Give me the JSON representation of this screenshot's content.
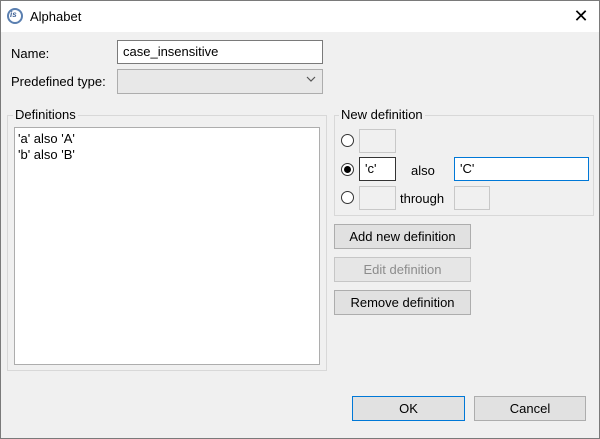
{
  "window": {
    "title": "Alphabet"
  },
  "form": {
    "name_label": "Name:",
    "name_value": "case_insensitive",
    "predefined_label": "Predefined type:",
    "predefined_value": ""
  },
  "definitions": {
    "title": "Definitions",
    "items": [
      "'a' also 'A'",
      "'b' also 'B'"
    ]
  },
  "new_definition": {
    "title": "New definition",
    "single_value": "",
    "also_from": "'c'",
    "also_label": "also",
    "also_to": "'C'",
    "through_from": "",
    "through_label": "through",
    "through_to": "",
    "selected_option": "also"
  },
  "buttons": {
    "add": "Add new definition",
    "edit": "Edit definition",
    "remove": "Remove definition",
    "ok": "OK",
    "cancel": "Cancel"
  },
  "icons": {
    "app": "app-logo-icon",
    "close": "close-icon",
    "dropdown": "chevron-down-icon"
  },
  "colors": {
    "focus_border": "#0078d7",
    "window_bg": "#f0f0f0"
  }
}
